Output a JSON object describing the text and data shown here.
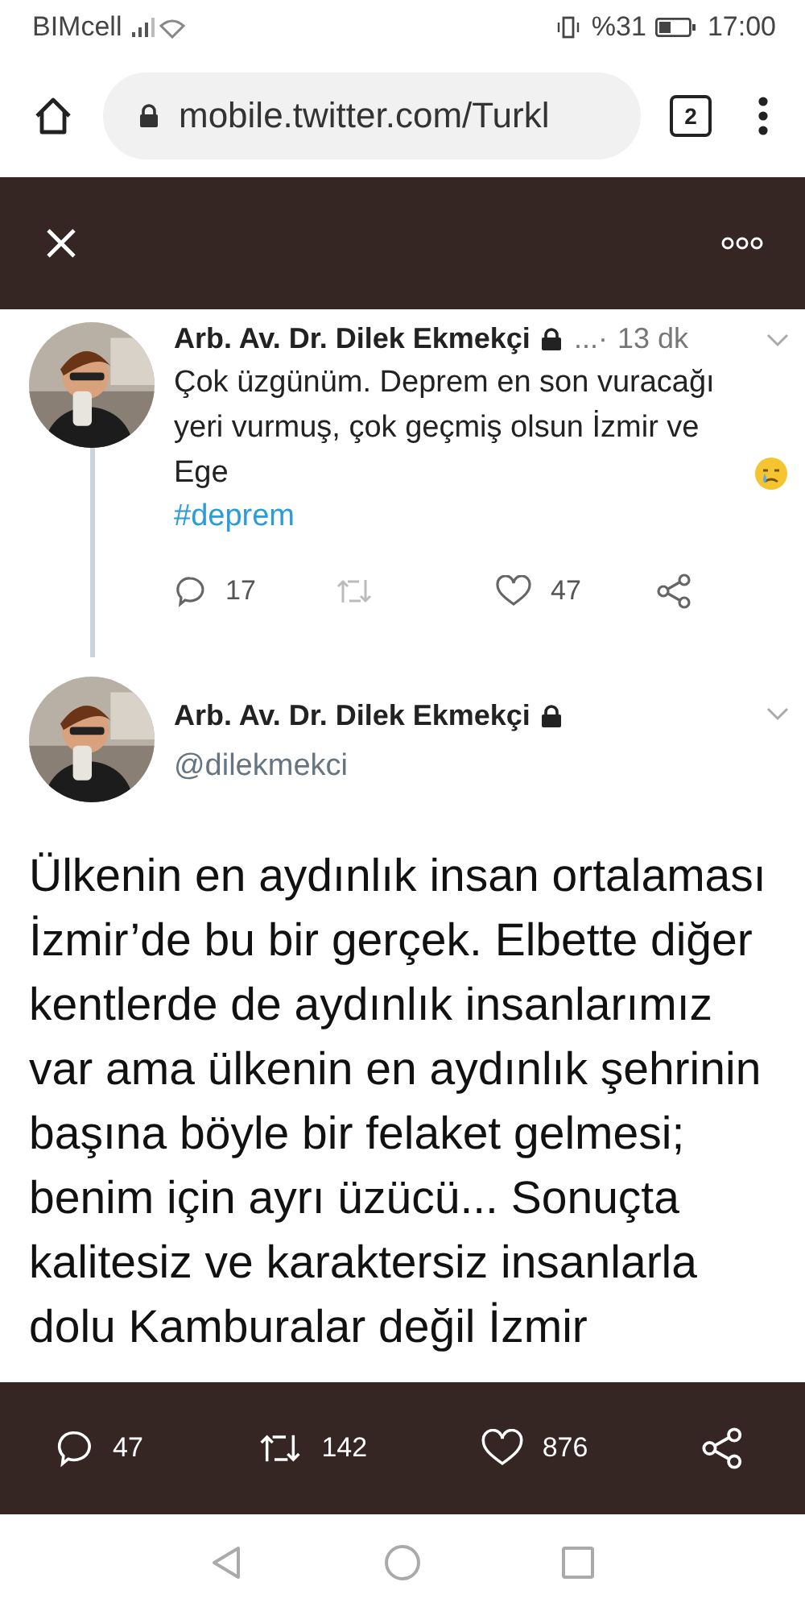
{
  "status_bar": {
    "carrier": "BIMcell",
    "battery": "%31",
    "time": "17:00"
  },
  "browser": {
    "url": "mobile.twitter.com/Turkl",
    "tab_count": "2"
  },
  "thread": [
    {
      "kind": "reply",
      "name": "Arb. Av. Dr. Dilek Ekmekçi",
      "ellipsis": "...·",
      "time": "13 dk",
      "text": "Çok üzgünüm. Deprem en son vuracağı yeri vurmuş, çok geçmiş olsun İzmir ve Ege",
      "hashtag": "#deprem",
      "replies": "17",
      "likes": "47"
    },
    {
      "kind": "main",
      "name": "Arb. Av. Dr. Dilek Ekmekçi",
      "handle": "@dilekmekci",
      "text": "Ülkenin en aydınlık insan ortalaması İzmir’de bu bir gerçek. Elbette diğer kentlerde de aydınlık insanlarımız var ama ülkenin en aydınlık şehrinin başına böyle bir felaket gelmesi; benim için ayrı üzücü... Sonuçta kalitesiz ve karaktersiz insanlarla dolu Kamburalar değil İzmir"
    }
  ],
  "action_bar": {
    "replies": "47",
    "retweets": "142",
    "likes": "876"
  }
}
